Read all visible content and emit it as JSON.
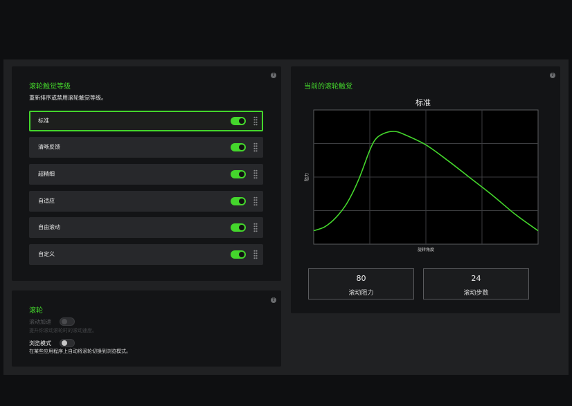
{
  "haptics": {
    "title": "滚轮触觉等级",
    "description": "重新排序或禁用滚轮触觉等级。",
    "levels": [
      {
        "label": "标准",
        "enabled": true,
        "selected": true
      },
      {
        "label": "清晰反馈",
        "enabled": true,
        "selected": false
      },
      {
        "label": "超精细",
        "enabled": true,
        "selected": false
      },
      {
        "label": "自适应",
        "enabled": true,
        "selected": false
      },
      {
        "label": "自由滚动",
        "enabled": true,
        "selected": false
      },
      {
        "label": "自定义",
        "enabled": true,
        "selected": false
      }
    ]
  },
  "wheel": {
    "title": "滚轮",
    "scroll_accel": {
      "label": "滚动加速",
      "description": "提升你滚动滚轮时的滚动速度。",
      "enabled": false,
      "disabled": true
    },
    "browse_mode": {
      "label": "浏览模式",
      "description": "在某些应用程序上自动将滚轮切换到浏览模式。",
      "enabled": false
    }
  },
  "current": {
    "title": "当前的滚轮触觉",
    "stats": [
      {
        "value": "80",
        "label": "滚动阻力"
      },
      {
        "value": "24",
        "label": "滚动步数"
      }
    ]
  },
  "chart_data": {
    "type": "line",
    "title": "标准",
    "xlabel": "旋转角度",
    "ylabel": "阻力",
    "grid": true,
    "legend": "none",
    "xlim": [
      0,
      1
    ],
    "ylim": [
      0,
      1
    ],
    "series": [
      {
        "values": [
          [
            0.0,
            0.1
          ],
          [
            0.05,
            0.13
          ],
          [
            0.1,
            0.2
          ],
          [
            0.15,
            0.31
          ],
          [
            0.2,
            0.48
          ],
          [
            0.25,
            0.7
          ],
          [
            0.28,
            0.79
          ],
          [
            0.32,
            0.83
          ],
          [
            0.36,
            0.84
          ],
          [
            0.4,
            0.82
          ],
          [
            0.5,
            0.74
          ],
          [
            0.6,
            0.62
          ],
          [
            0.7,
            0.49
          ],
          [
            0.8,
            0.36
          ],
          [
            0.9,
            0.22
          ],
          [
            1.0,
            0.1
          ]
        ]
      }
    ],
    "line_color": "#44d62c"
  },
  "colors": {
    "accent": "#44d62c",
    "panel": "#131416",
    "row": "#27282b"
  },
  "icons": {
    "help": "question-circle-icon",
    "drag": "drag-handle-icon"
  }
}
